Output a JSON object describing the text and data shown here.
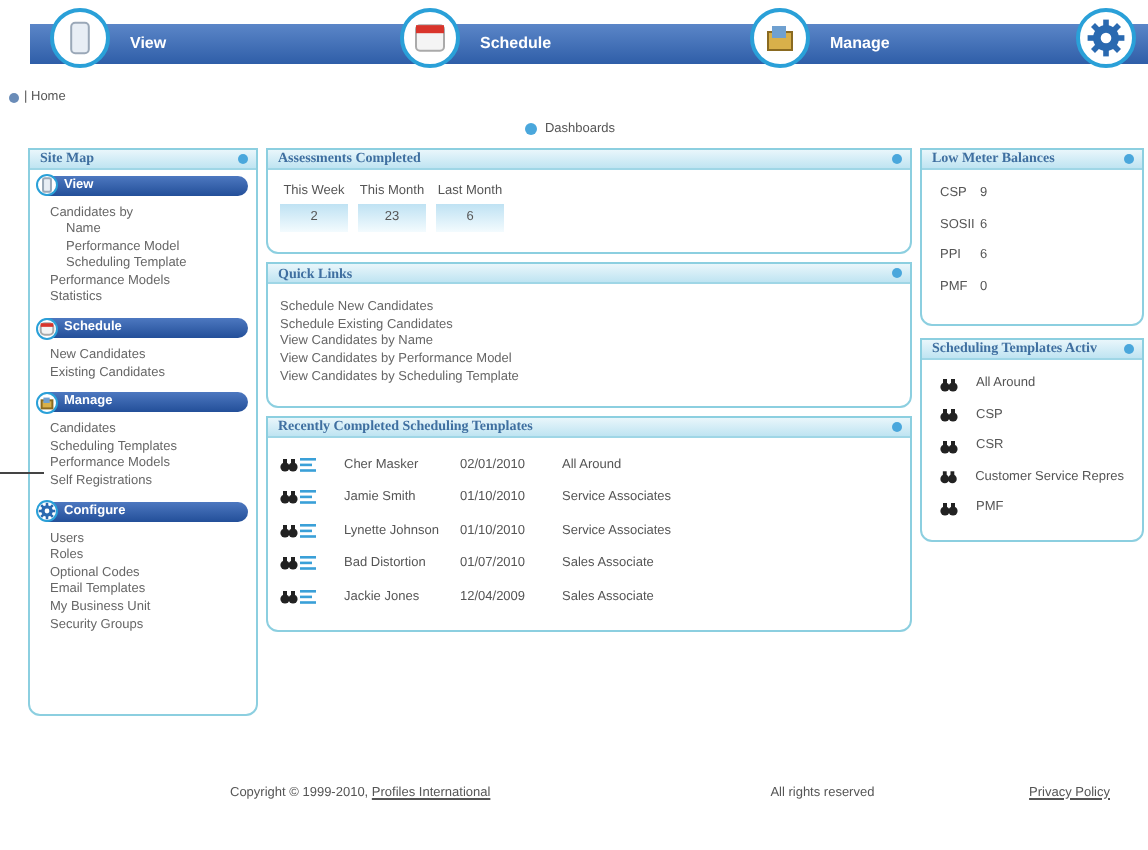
{
  "nav": [
    {
      "label": "View",
      "kind": "view"
    },
    {
      "label": "Schedule",
      "kind": "schedule"
    },
    {
      "label": "Manage",
      "kind": "manage"
    },
    {
      "kind": "configure"
    }
  ],
  "breadcrumb": "| Home",
  "dashboards": "Dashboards",
  "site_map": {
    "title": "Site Map",
    "sections": [
      {
        "title": "View",
        "kind": "view",
        "items": [
          {
            "label": "Candidates by",
            "children": [
              {
                "label": "Name"
              },
              {
                "label": "Performance Model"
              },
              {
                "label": "Scheduling Template"
              }
            ]
          },
          {
            "label": "Performance Models"
          },
          {
            "label": "Statistics"
          }
        ]
      },
      {
        "title": "Schedule",
        "kind": "schedule",
        "items": [
          {
            "label": "New Candidates"
          },
          {
            "label": "Existing Candidates"
          }
        ]
      },
      {
        "title": "Manage",
        "kind": "manage",
        "items": [
          {
            "label": "Candidates"
          },
          {
            "label": "Scheduling Templates"
          },
          {
            "label": "Performance Models"
          },
          {
            "label": "Self Registrations"
          }
        ]
      },
      {
        "title": "Configure",
        "kind": "configure",
        "items": [
          {
            "label": "Users"
          },
          {
            "label": "Roles"
          },
          {
            "label": "Optional Codes"
          },
          {
            "label": "Email Templates"
          },
          {
            "label": "My Business Unit"
          },
          {
            "label": "Security Groups"
          }
        ]
      }
    ]
  },
  "assessments": {
    "title": "Assessments Completed",
    "stats": [
      {
        "label": "This Week",
        "value": "2"
      },
      {
        "label": "This Month",
        "value": "23"
      },
      {
        "label": "Last Month",
        "value": "6"
      }
    ]
  },
  "quick_links": {
    "title": "Quick Links",
    "links": [
      "Schedule New Candidates",
      "Schedule Existing Candidates",
      "View Candidates by Name",
      "View Candidates by Performance Model",
      "View Candidates by Scheduling Template"
    ]
  },
  "recent": {
    "title": "Recently Completed Scheduling Templates",
    "rows": [
      {
        "name": "Cher Masker",
        "date": "02/01/2010",
        "template": "All Around"
      },
      {
        "name": "Jamie Smith",
        "date": "01/10/2010",
        "template": "Service Associates"
      },
      {
        "name": "Lynette Johnson",
        "date": "01/10/2010",
        "template": "Service Associates"
      },
      {
        "name": "Bad Distortion",
        "date": "01/07/2010",
        "template": "Sales Associate"
      },
      {
        "name": "Jackie Jones",
        "date": "12/04/2009",
        "template": "Sales Associate"
      }
    ]
  },
  "low_meter": {
    "title": "Low Meter Balances",
    "rows": [
      {
        "code": "CSP",
        "value": "9"
      },
      {
        "code": "SOSII",
        "value": "6"
      },
      {
        "code": "PPI",
        "value": "6"
      },
      {
        "code": "PMF",
        "value": "0"
      }
    ]
  },
  "templates_active": {
    "title": "Scheduling Templates Activ",
    "items": [
      "All Around",
      "CSP",
      "CSR",
      "Customer Service Repres",
      "PMF"
    ]
  },
  "footer": {
    "copyright": "Copyright © 1999-2010, ",
    "company": "Profiles International",
    "rights": "All rights reserved",
    "privacy": "Privacy Policy"
  }
}
